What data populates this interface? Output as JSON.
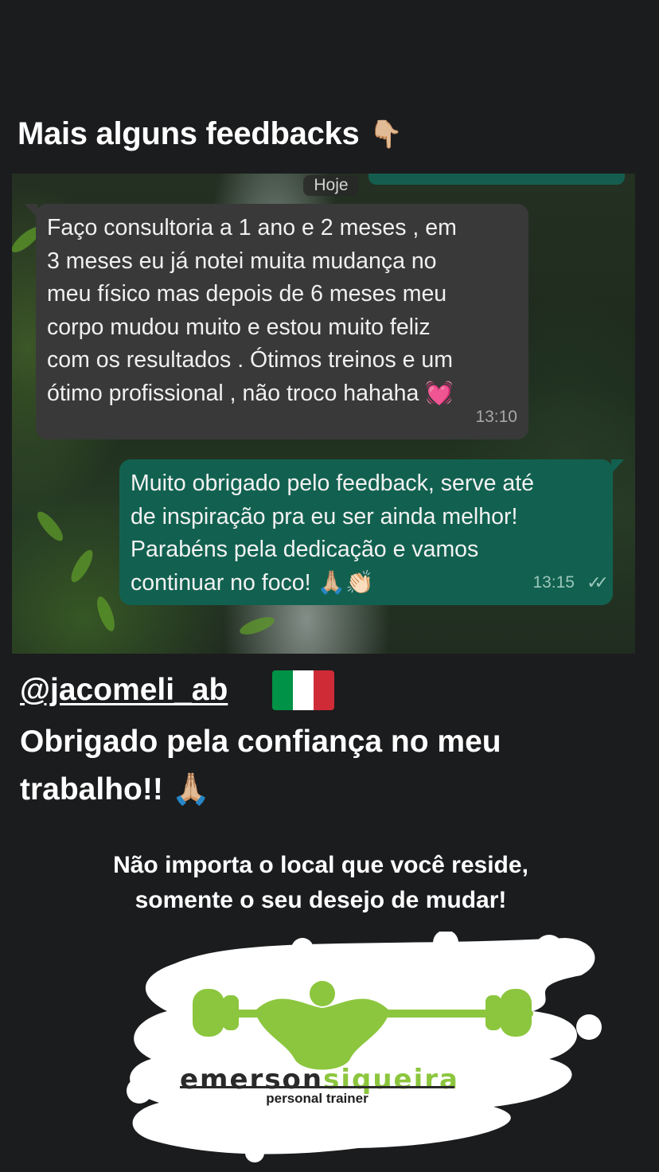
{
  "story": {
    "heading": "Mais alguns feedbacks",
    "heading_emoji": "👇🏼",
    "handle": "@jacomeli_ab",
    "thanks": "Obrigado pela confiança no meu trabalho!! 🙏🏼",
    "motto_line1": "Não importa o local que você reside,",
    "motto_line2": "somente o seu desejo de mudar!"
  },
  "chat": {
    "date_label": "Hoje",
    "messages": [
      {
        "direction": "incoming",
        "text": "Faço consultoria a 1 ano e 2 meses , em\n3 meses eu já notei muita mudança no\nmeu físico mas depois de 6 meses meu\ncorpo mudou muito e estou muito feliz\ncom os resultados . Ótimos treinos e um\nótimo profissional , não troco hahaha 💓",
        "time": "13:10"
      },
      {
        "direction": "outgoing",
        "text": "Muito obrigado pelo feedback, serve até\nde inspiração pra eu ser ainda melhor!\nParabéns pela dedicação e vamos\ncontinuar no foco! 🙏🏼👏🏻",
        "time": "13:15",
        "status": "read"
      }
    ]
  },
  "logo": {
    "brand_part1": "emerson",
    "brand_part2": "siqueira",
    "tagline": "personal trainer",
    "accent_color": "#8cc63e"
  },
  "flag_colors": [
    "#009246",
    "#ffffff",
    "#ce2b37"
  ]
}
